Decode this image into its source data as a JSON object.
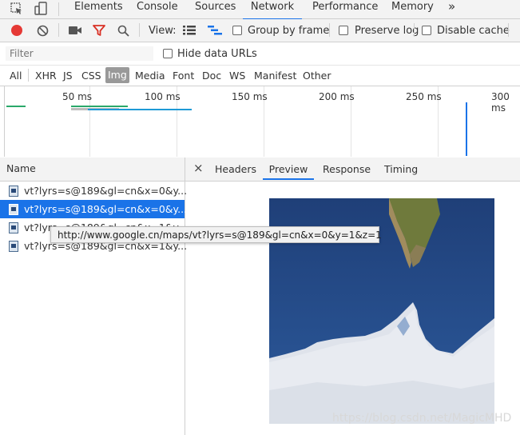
{
  "tabs": {
    "elements": "Elements",
    "console": "Console",
    "sources": "Sources",
    "network": "Network",
    "performance": "Performance",
    "memory": "Memory",
    "more": "»"
  },
  "toolbar": {
    "view_label": "View:",
    "group_by_frame": "Group by frame",
    "preserve_log": "Preserve log",
    "disable_cache": "Disable cache"
  },
  "filter": {
    "placeholder": "Filter",
    "hide_data_urls": "Hide data URLs"
  },
  "types": [
    "All",
    "XHR",
    "JS",
    "CSS",
    "Img",
    "Media",
    "Font",
    "Doc",
    "WS",
    "Manifest",
    "Other"
  ],
  "timeline": {
    "ticks": [
      "50 ms",
      "100 ms",
      "150 ms",
      "200 ms",
      "250 ms",
      "300 ms"
    ]
  },
  "requests": {
    "header": "Name",
    "rows": [
      "vt?lyrs=s@189&gl=cn&x=0&y...",
      "vt?lyrs=s@189&gl=cn&x=0&y...",
      "vt?lyrs=s@189&gl=cn&x=1&y...",
      "vt?lyrs=s@189&gl=cn&x=1&y..."
    ]
  },
  "detail_tabs": {
    "close": "×",
    "headers": "Headers",
    "preview": "Preview",
    "response": "Response",
    "timing": "Timing"
  },
  "tooltip": "http://www.google.cn/maps/vt?lyrs=s@189&gl=cn&x=0&y=1&z=1",
  "watermark": "https://blog.csdn.net/MagicMHD",
  "colors": {
    "accent": "#1a73e8",
    "record": "#e53935",
    "filter_icon": "#d93025"
  }
}
